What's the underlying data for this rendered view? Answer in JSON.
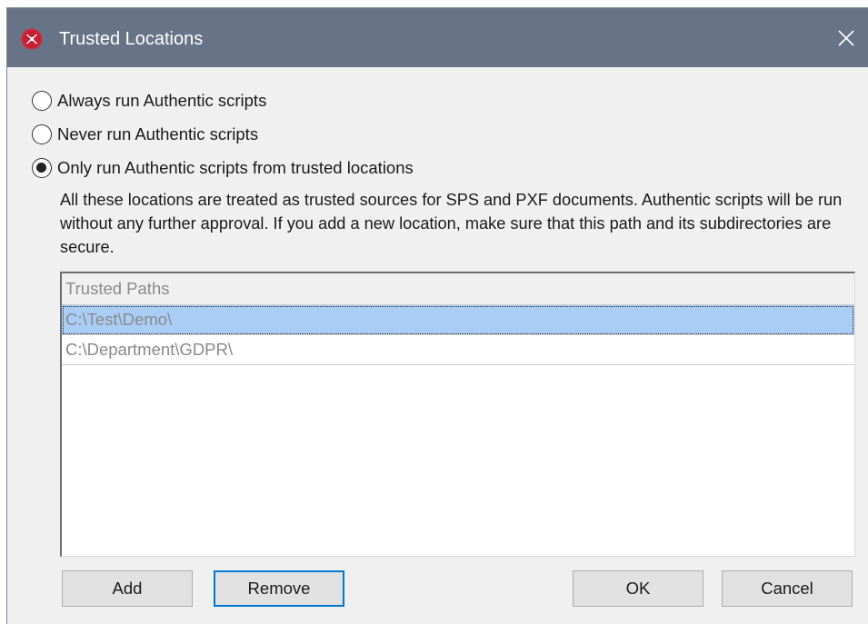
{
  "window": {
    "title": "Trusted Locations",
    "icon": "altova-app-icon",
    "close_glyph": "✕"
  },
  "options": [
    {
      "label": "Always run Authentic scripts",
      "checked": false
    },
    {
      "label": "Never run Authentic scripts",
      "checked": false
    },
    {
      "label": "Only run Authentic scripts from trusted locations",
      "checked": true
    }
  ],
  "description": "All these locations are treated as trusted sources for SPS and PXF documents. Authentic scripts will be run without any further approval. If you add a new location, make sure that this path and its subdirectories are secure.",
  "list": {
    "header": "Trusted Paths",
    "rows": [
      {
        "path": "C:\\Test\\Demo\\",
        "selected": true
      },
      {
        "path": "C:\\Department\\GDPR\\",
        "selected": false
      }
    ]
  },
  "buttons": {
    "add": "Add",
    "remove": "Remove",
    "ok": "OK",
    "cancel": "Cancel"
  },
  "colors": {
    "titlebar": "#677386",
    "selection": "#aacdf5",
    "focus": "#0078d7"
  }
}
